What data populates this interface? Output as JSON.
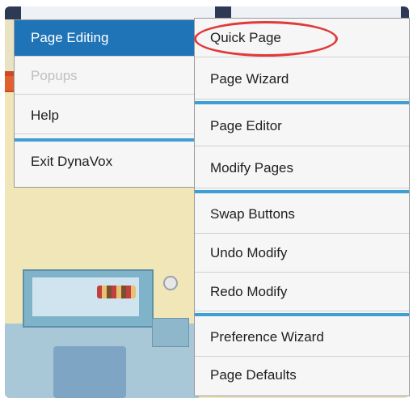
{
  "main_menu": {
    "items": [
      {
        "label": "Page Editing",
        "state": "selected"
      },
      {
        "label": "Popups",
        "state": "disabled"
      },
      {
        "label": "Help",
        "state": "normal"
      },
      {
        "label": "Exit DynaVox",
        "state": "normal"
      }
    ]
  },
  "submenu": {
    "items": [
      {
        "label": "Quick Page",
        "annotated": true
      },
      {
        "label": "Page Wizard"
      },
      {
        "label": "Page Editor"
      },
      {
        "label": "Modify Pages"
      },
      {
        "label": "Swap Buttons"
      },
      {
        "label": "Undo Modify"
      },
      {
        "label": "Redo Modify"
      },
      {
        "label": "Preference Wizard"
      },
      {
        "label": "Page Defaults"
      }
    ]
  },
  "colors": {
    "selection": "#1f74b8",
    "separator": "#3f9fd4",
    "annotation": "#e03a3a",
    "disabled_text": "#c0c0c0"
  },
  "icons": [
    "settings-dial-icon"
  ]
}
